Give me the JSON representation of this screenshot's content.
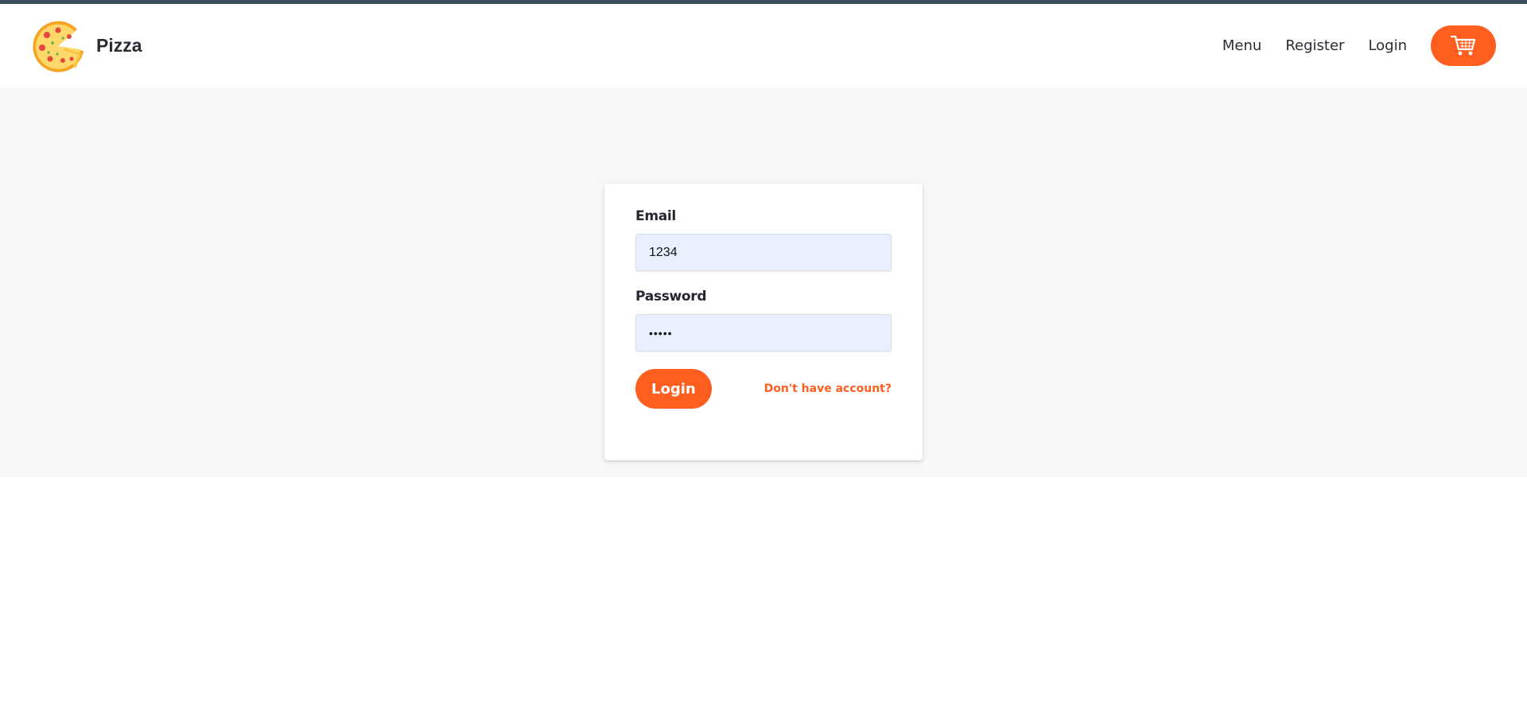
{
  "navbar": {
    "brand_name": "Pizza",
    "links": [
      {
        "label": "Menu"
      },
      {
        "label": "Register"
      },
      {
        "label": "Login"
      }
    ],
    "cart_icon": "shopping-cart-icon"
  },
  "login_form": {
    "email_label": "Email",
    "email_value": "1234",
    "password_label": "Password",
    "password_value": "•••••",
    "submit_label": "Login",
    "register_link": "Don't have account?"
  },
  "colors": {
    "accent": "#ff5e1f",
    "topbar": "#3d4f5a",
    "input_bg": "#e8f0fe",
    "band_bg": "#f7f7f7"
  }
}
